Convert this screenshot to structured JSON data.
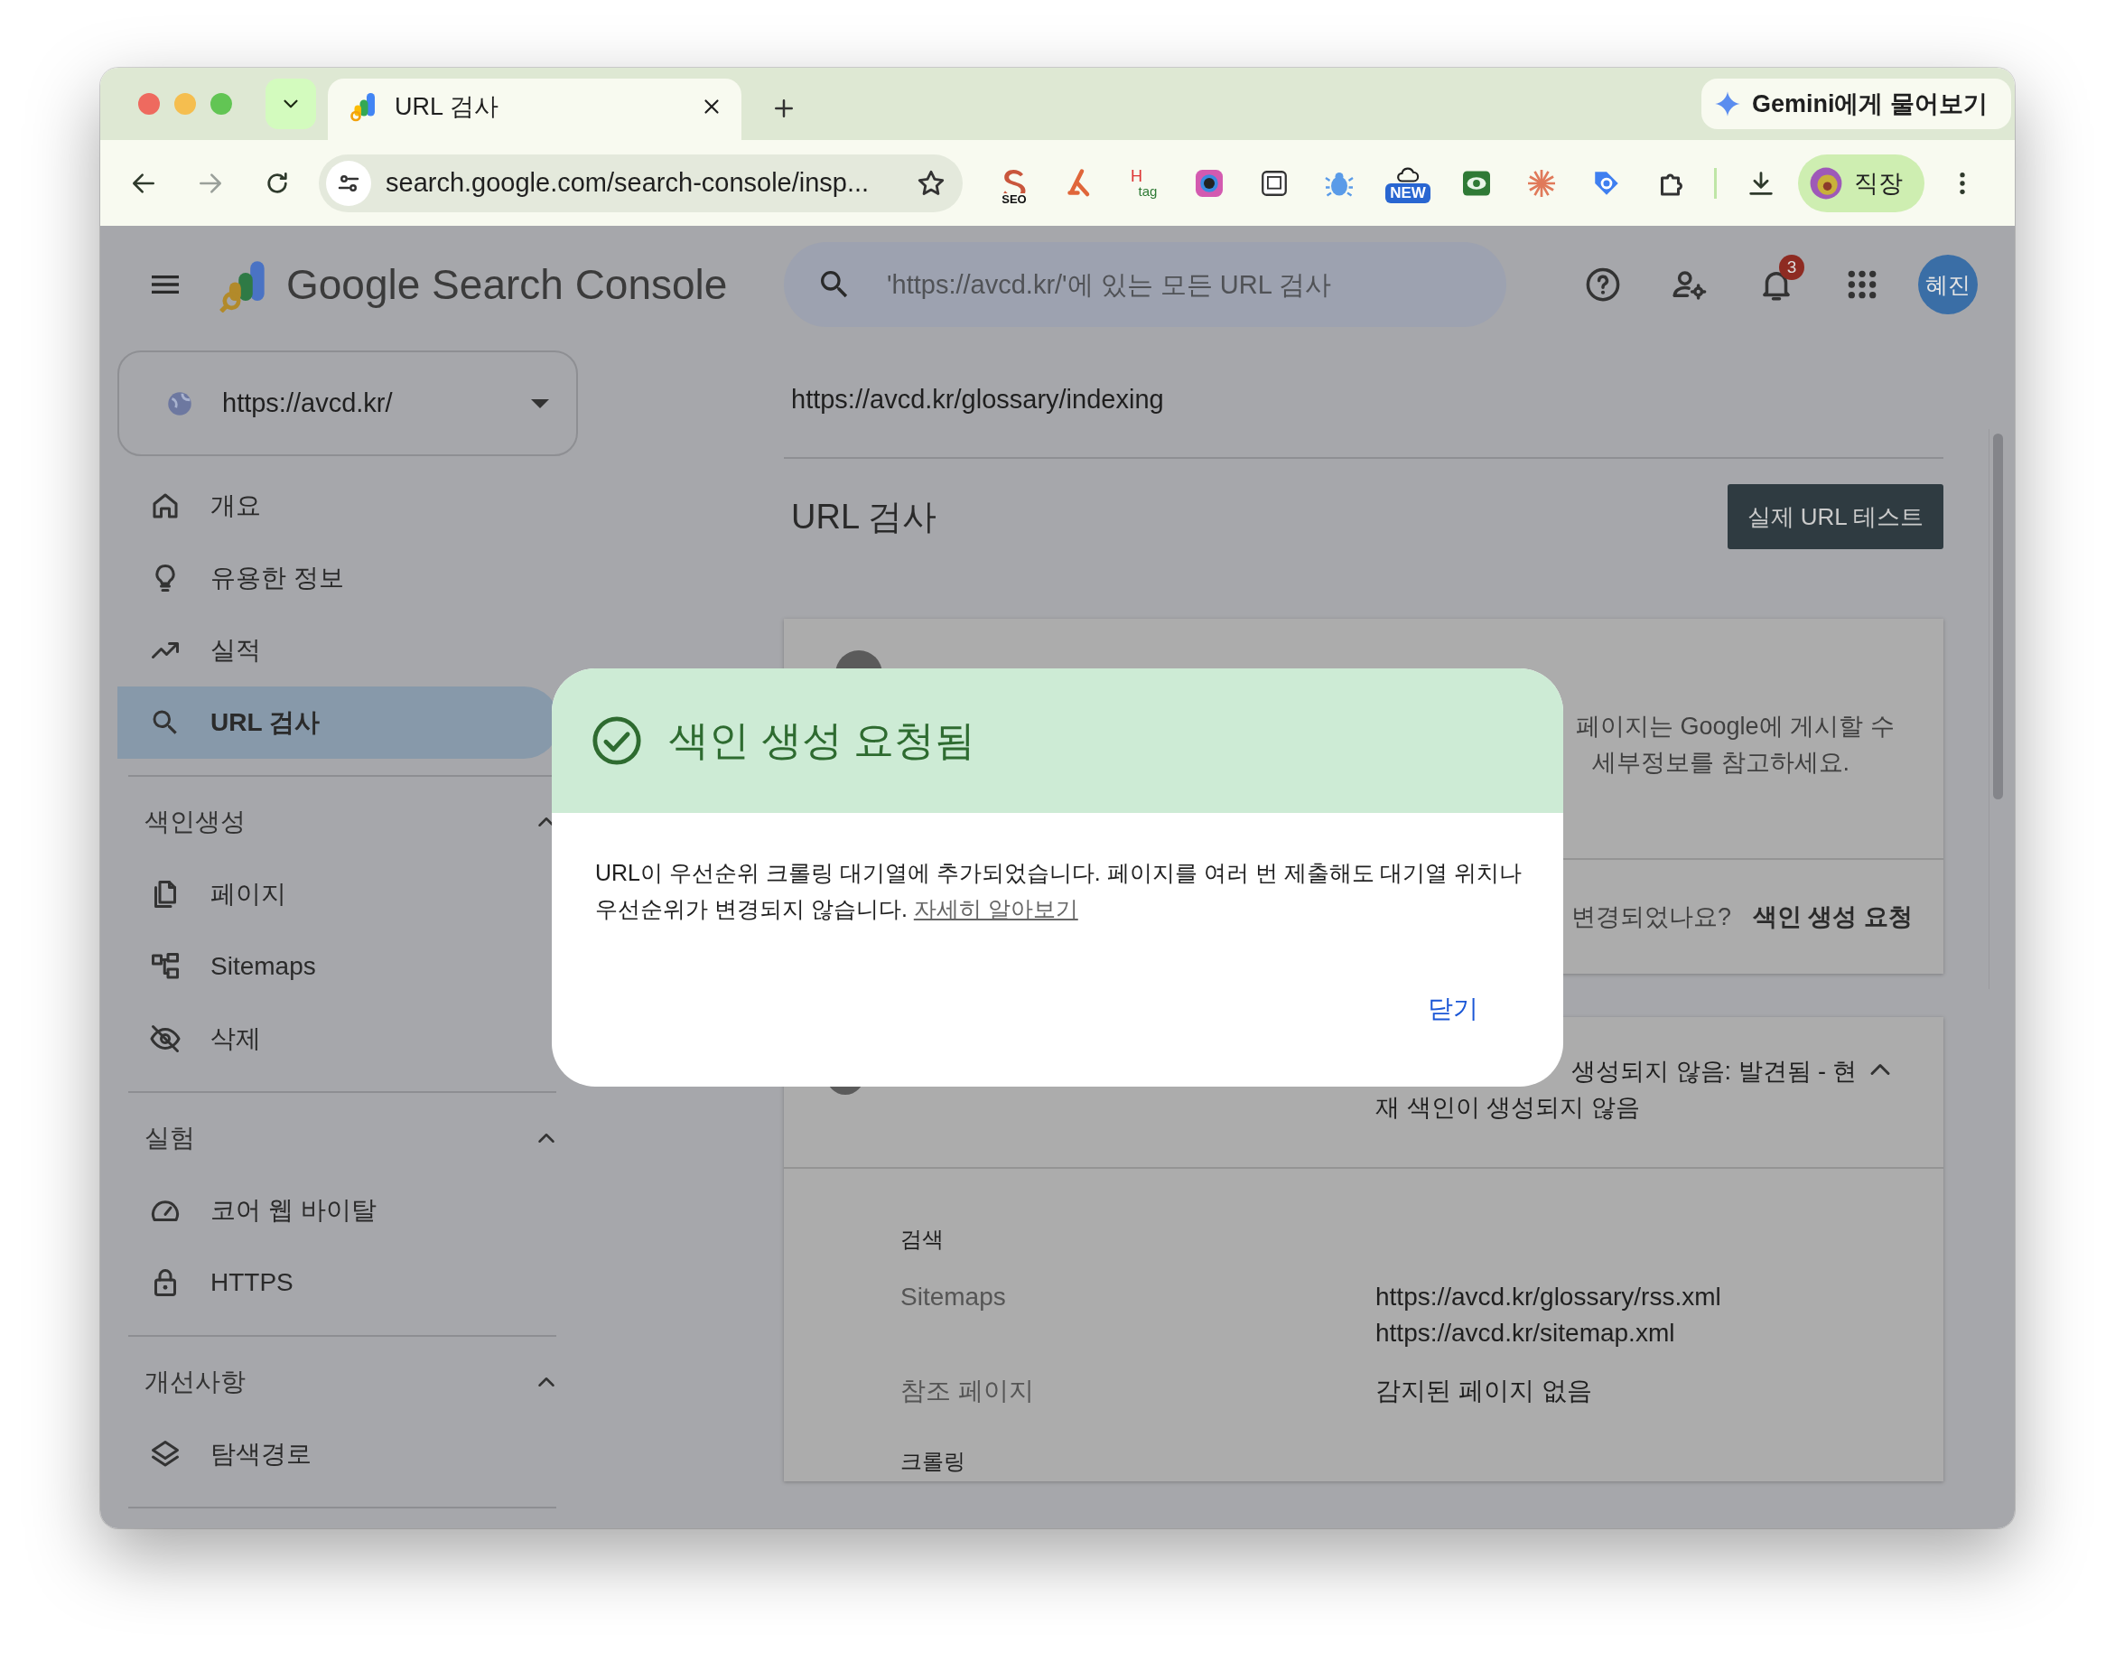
{
  "browser": {
    "tabs": [
      {
        "title": "URL 검사",
        "selected": true
      }
    ],
    "gemini_button": "Gemini에게 물어보기",
    "address": "search.google.com/search-console/insp...",
    "extensions": [
      {
        "kind": "seo",
        "label": "SEO"
      },
      {
        "kind": "fork"
      },
      {
        "kind": "htag",
        "label": "H",
        "sublabel": "tag"
      },
      {
        "kind": "lens"
      },
      {
        "kind": "note"
      },
      {
        "kind": "bug"
      },
      {
        "kind": "cloud",
        "label": "NEW"
      },
      {
        "kind": "eye"
      },
      {
        "kind": "burst"
      },
      {
        "kind": "tag"
      },
      {
        "kind": "puzzle"
      }
    ],
    "profile": "직장"
  },
  "app": {
    "product_name": "Google Search Console",
    "search_placeholder": "'https://avcd.kr/'에 있는 모든 URL 검사",
    "notification_count": "3",
    "avatar": "혜진"
  },
  "sidebar": {
    "property": "https://avcd.kr/",
    "top_items": [
      {
        "label": "개요",
        "kind": "home",
        "selected": false
      },
      {
        "label": "유용한 정보",
        "kind": "bulb",
        "selected": false
      },
      {
        "label": "실적",
        "kind": "trend",
        "selected": false
      },
      {
        "label": "URL 검사",
        "kind": "search",
        "selected": true
      }
    ],
    "sections": [
      {
        "title": "색인생성",
        "expanded": true,
        "items": [
          {
            "label": "페이지",
            "kind": "pages",
            "selected": false
          },
          {
            "label": "Sitemaps",
            "kind": "sitemap",
            "selected": false
          },
          {
            "label": "삭제",
            "kind": "eyeoff",
            "selected": false
          }
        ]
      },
      {
        "title": "실험",
        "expanded": true,
        "items": [
          {
            "label": "코어 웹 바이탈",
            "kind": "gauge",
            "selected": false
          },
          {
            "label": "HTTPS",
            "kind": "lock",
            "selected": false
          }
        ]
      },
      {
        "title": "개선사항",
        "expanded": true,
        "items": [
          {
            "label": "탐색경로",
            "kind": "layers",
            "selected": false
          }
        ]
      }
    ]
  },
  "main": {
    "inspected_url": "https://avcd.kr/glossary/indexing",
    "heading": "URL 검사",
    "test_button": "실제 URL 테스트",
    "status_card": {
      "description_lines": [
        "페이지는 Google에 게시할 수",
        "세부정보를 참고하세요."
      ],
      "question": "변경되었나요?",
      "action": "색인 생성 요청"
    },
    "detail_card": {
      "status_lines": [
        "생성되지 않음: 발견됨 - 현",
        "재 색인이 생성되지 않음"
      ],
      "expanded": true,
      "groups": [
        {
          "title": "검색",
          "rows": [
            {
              "label": "Sitemaps",
              "values": [
                "https://avcd.kr/glossary/rss.xml",
                "https://avcd.kr/sitemap.xml"
              ]
            },
            {
              "label": "참조 페이지",
              "values": [
                "감지된 페이지 없음"
              ]
            }
          ]
        },
        {
          "title": "크롤링"
        }
      ]
    }
  },
  "dialog": {
    "title": "색인 생성 요청됨",
    "body": "URL이 우선순위 크롤링 대기열에 추가되었습니다. 페이지를 여러 번 제출해도 대기열 위치나 우선순위가 변경되지 않습니다.",
    "link": "자세히 알아보기",
    "close": "닫기"
  }
}
